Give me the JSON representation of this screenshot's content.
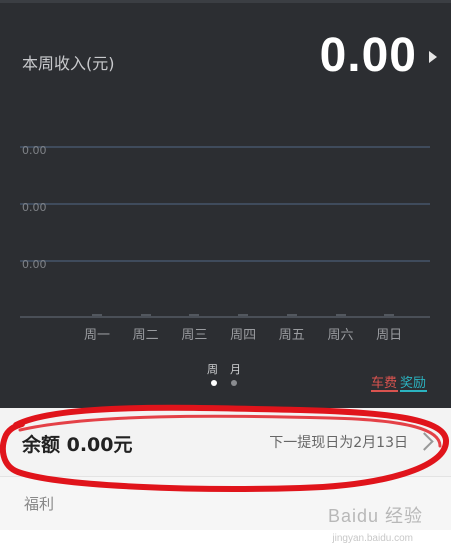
{
  "header": {
    "week_income_label": "本周收入(元)",
    "week_income_value": "0.00",
    "arrow_icon": "triangle-right-icon"
  },
  "chart_data": {
    "type": "bar",
    "categories": [
      "周一",
      "周二",
      "周三",
      "周四",
      "周五",
      "周六",
      "周日"
    ],
    "series": [
      {
        "name": "车费",
        "values": [
          0,
          0,
          0,
          0,
          0,
          0,
          0
        ],
        "color": "#d9534f"
      },
      {
        "name": "奖励",
        "values": [
          0,
          0,
          0,
          0,
          0,
          0,
          0
        ],
        "color": "#2bb3c0"
      }
    ],
    "y_tick_labels": [
      "0.00",
      "0.00",
      "0.00"
    ],
    "grid": true,
    "legend_placement": "bottom-right"
  },
  "period_tabs": {
    "labels": [
      "周",
      "月"
    ],
    "active_index": 0,
    "dot_active_color": "#ffffff",
    "dot_inactive_color": "#8a8c90"
  },
  "balance": {
    "label": "余额 0.00元",
    "next_withdrawal": "下一提现日为2月13日",
    "chevron_icon": "chevron-right-icon"
  },
  "benefits": {
    "title": "福利"
  },
  "watermark": {
    "text": "Baidu 经验",
    "subtext": "jingyan.baidu.com"
  },
  "colors": {
    "panel_bg": "#2c2e32",
    "gridline": "#3f4b5c",
    "annotation_red": "#e0141b"
  }
}
